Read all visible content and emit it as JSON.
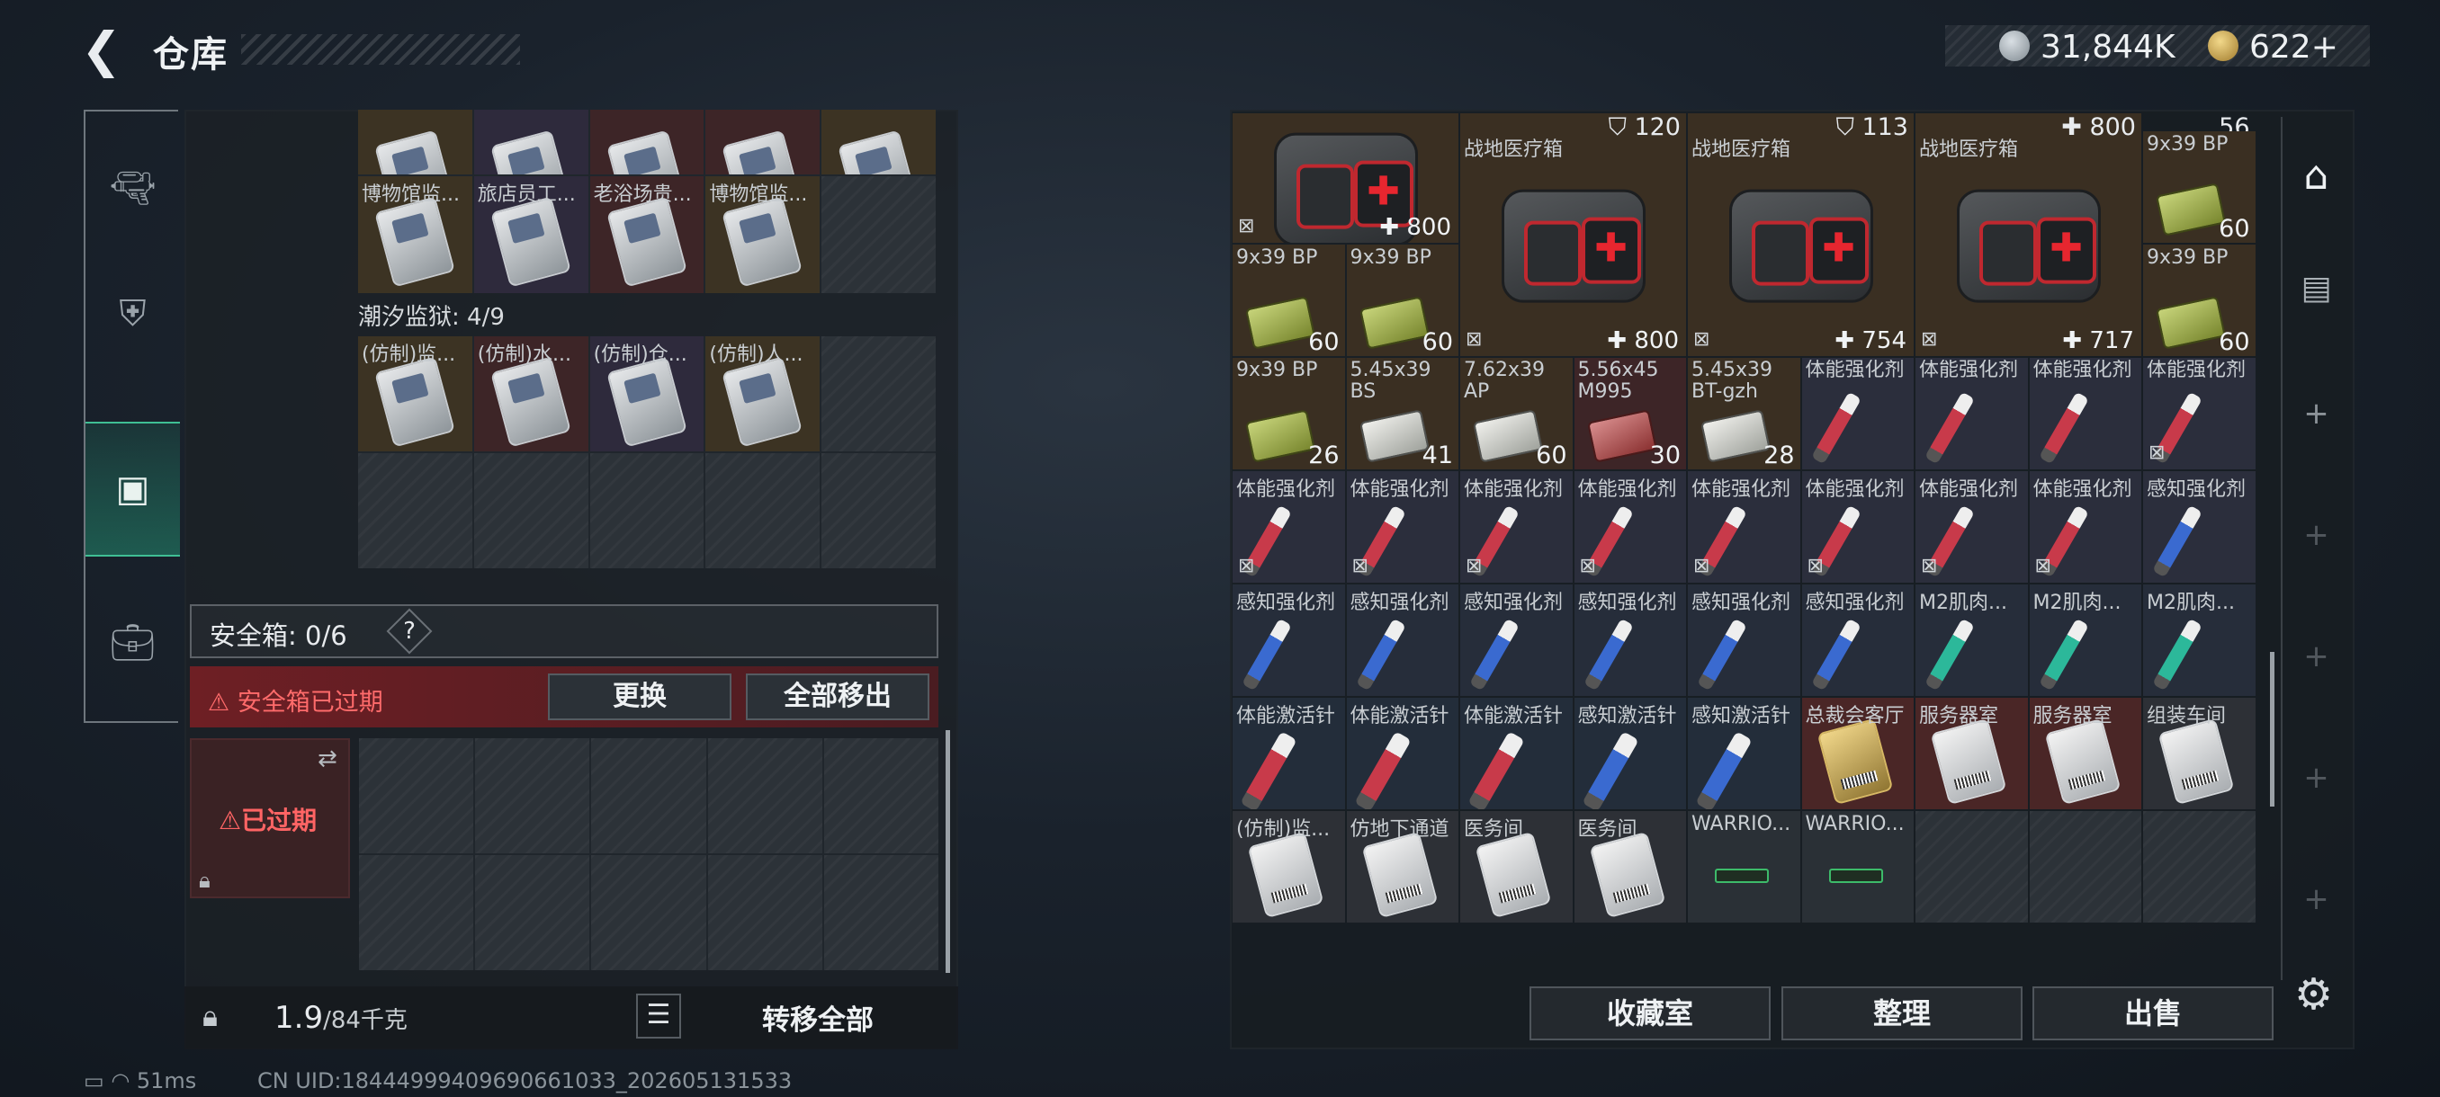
{
  "header": {
    "title": "仓库",
    "back_icon": "back-arrow-icon"
  },
  "currency": {
    "silver": "31,844K",
    "gold": "622+"
  },
  "left_sidebar": {
    "items": [
      {
        "icon": "gun-icon"
      },
      {
        "icon": "armor-icon"
      },
      {
        "icon": "backpack-icon",
        "selected": true
      },
      {
        "icon": "briefcase-icon"
      }
    ]
  },
  "left_panel": {
    "top_grid": [
      {
        "name": "",
        "bg": "gold"
      },
      {
        "name": "",
        "bg": "purple"
      },
      {
        "name": "",
        "bg": "red"
      },
      {
        "name": "",
        "bg": "red"
      },
      {
        "name": "",
        "bg": "gold"
      },
      {
        "name": "博物馆监...",
        "bg": "gold"
      },
      {
        "name": "旅店员工...",
        "bg": "purple"
      },
      {
        "name": "老浴场贵...",
        "bg": "red"
      },
      {
        "name": "博物馆监...",
        "bg": "gold"
      },
      {
        "name": "",
        "bg": "empty"
      }
    ],
    "tide_label": "潮汐监狱: 4/9",
    "tide_grid": [
      {
        "name": "(仿制)监...",
        "bg": "gold"
      },
      {
        "name": "(仿制)水...",
        "bg": "red"
      },
      {
        "name": "(仿制)仓...",
        "bg": "purple"
      },
      {
        "name": "(仿制)人...",
        "bg": "gold"
      },
      {
        "name": "",
        "bg": "empty"
      }
    ],
    "safe_box_label": "安全箱: 0/6",
    "safe_help": "?",
    "expired_text": "安全箱已过期",
    "replace_button": "更换",
    "move_all_button": "全部移出",
    "case_label": "已过期",
    "weight_value": "1.9",
    "weight_max": "/84千克",
    "transfer_all": "转移全部"
  },
  "right_panel": {
    "top_values": [
      "120",
      "113",
      "800",
      "56"
    ],
    "medkit_label": "战地医疗箱",
    "medkits": [
      {
        "value": "800"
      },
      {
        "name": "战地医疗箱",
        "value": "800"
      },
      {
        "name": "战地医疗箱",
        "value": "754"
      },
      {
        "name": "战地医疗箱",
        "value": "717"
      }
    ],
    "ammo_top": [
      {
        "name": "9x39 BP",
        "count": "60"
      },
      {
        "name": "9x39 BP",
        "count": "60"
      },
      {
        "name": "9x39 BP",
        "count": "60"
      },
      {
        "name": "9x39 BP",
        "count": "60"
      }
    ],
    "row3": [
      {
        "name": "9x39 BP",
        "count": "26",
        "type": "ammo"
      },
      {
        "name": "5.45x39 BS",
        "count": "41",
        "type": "ammo-s"
      },
      {
        "name": "7.62x39 AP",
        "count": "60",
        "type": "ammo-s"
      },
      {
        "name": "5.56x45 M995",
        "count": "30",
        "type": "ammo-r"
      },
      {
        "name": "5.45x39 BT-gzh",
        "count": "28",
        "type": "ammo-s"
      },
      {
        "name": "体能强化剂",
        "type": "syr"
      },
      {
        "name": "体能强化剂",
        "type": "syr"
      },
      {
        "name": "体能强化剂",
        "type": "syr"
      },
      {
        "name": "体能强化剂",
        "type": "syr"
      }
    ],
    "row4": [
      "体能强化剂",
      "体能强化剂",
      "体能强化剂",
      "体能强化剂",
      "体能强化剂",
      "体能强化剂",
      "体能强化剂",
      "体能强化剂",
      "感知强化剂"
    ],
    "row5": [
      "感知强化剂",
      "感知强化剂",
      "感知强化剂",
      "感知强化剂",
      "感知强化剂",
      "感知强化剂",
      "M2肌肉...",
      "M2肌肉...",
      "M2肌肉..."
    ],
    "row6": [
      "体能激活针",
      "体能激活针",
      "体能激活针",
      "感知激活针",
      "感知激活针",
      "总裁会客厅",
      "服务器室",
      "服务器室",
      "组装车间"
    ],
    "row7": [
      "(仿制)监...",
      "仿地下通道",
      "医务间",
      "医务间",
      "WARRIO...",
      "WARRIO...",
      "",
      "",
      ""
    ],
    "buttons": {
      "collection": "收藏室",
      "sort": "整理",
      "sell": "出售"
    }
  },
  "right_sidebar": {
    "icons": [
      "warehouse-icon",
      "vehicle-icon",
      "plus-icon",
      "plus-icon",
      "plus-icon",
      "plus-icon",
      "plus-icon"
    ]
  },
  "status": {
    "ping": "51ms",
    "uid": "CN UID:18444999409690661033_202605131533"
  }
}
